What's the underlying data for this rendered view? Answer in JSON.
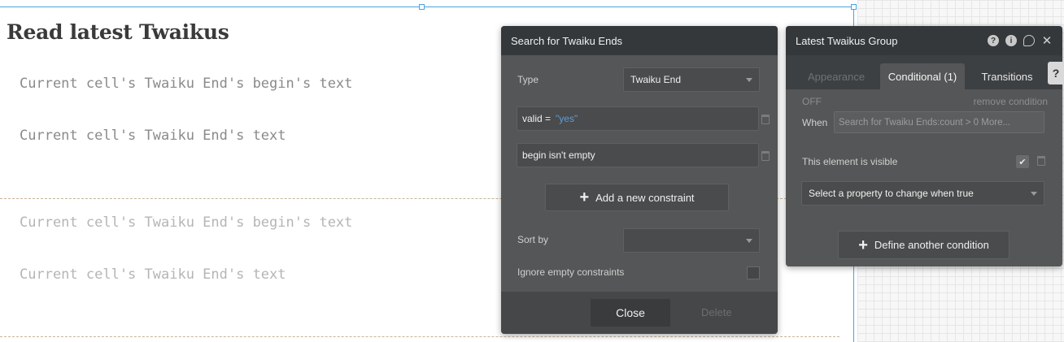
{
  "canvas": {
    "page_title": "Read latest Twaikus",
    "cells": [
      {
        "begin_text": "Current cell's Twaiku End's begin's text",
        "text": "Current cell's Twaiku End's text"
      },
      {
        "begin_text": "Current cell's Twaiku End's begin's text",
        "text": "Current cell's Twaiku End's text"
      }
    ]
  },
  "search_panel": {
    "title": "Search for Twaiku Ends",
    "type_label": "Type",
    "type_value": "Twaiku End",
    "constraints": [
      {
        "field": "valid =",
        "value": "\"yes\""
      },
      {
        "field": "begin isn't empty",
        "value": ""
      }
    ],
    "add_constraint_label": "Add a new constraint",
    "sort_by_label": "Sort by",
    "sort_by_value": "",
    "ignore_empty_label": "Ignore empty constraints",
    "close_label": "Close",
    "delete_label": "Delete"
  },
  "group_panel": {
    "title": "Latest Twaikus Group",
    "tabs": [
      {
        "label": "Appearance",
        "state": "dim"
      },
      {
        "label": "Conditional (1)",
        "state": "active"
      },
      {
        "label": "Transitions",
        "state": "normal"
      }
    ],
    "off_label": "OFF",
    "remove_condition_label": "remove condition",
    "when_label": "When",
    "when_value": "Search for Twaiku Ends:count > 0 More...",
    "visible_label": "This element is visible",
    "property_placeholder": "Select a property to change when true",
    "define_condition_label": "Define another condition",
    "help_label": "?"
  }
}
